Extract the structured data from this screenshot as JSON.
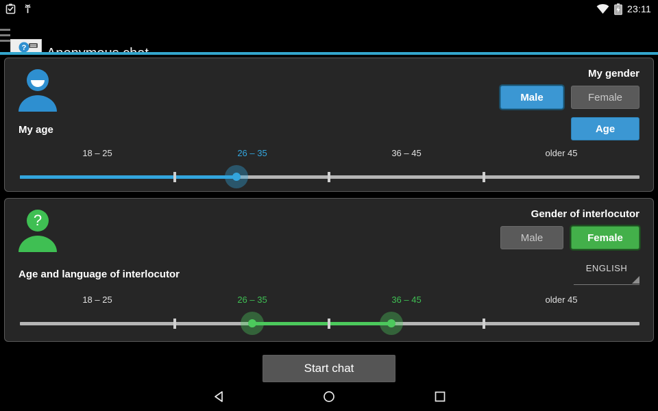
{
  "status_bar": {
    "time": "23:11",
    "left_icons": [
      "clipboard-check-icon",
      "android-robot-icon"
    ],
    "right_icons": [
      "wifi-icon",
      "battery-charging-icon"
    ]
  },
  "action_bar": {
    "title": "Anonymous chat",
    "menu_icon": "hamburger-menu-icon",
    "app_icon": "anonymous-chat-app-icon",
    "accent_color": "#33a5cc"
  },
  "my_section": {
    "gender_title": "My gender",
    "avatar_icon": "male-user-avatar-icon",
    "avatar_color": "#2e8fd0",
    "gender_options": [
      {
        "label": "Male",
        "selected": true,
        "color": "#3b97d3"
      },
      {
        "label": "Female",
        "selected": false,
        "color": "#5a5a5a"
      }
    ],
    "age_label": "My age",
    "age_button": {
      "label": "Age",
      "color": "#3b97d3"
    },
    "slider": {
      "accent_color": "#33a5dd",
      "labels": [
        "18 – 25",
        "26 – 35",
        "36 – 45",
        "older 45"
      ],
      "active_index": 1,
      "value_label": "26 – 35"
    }
  },
  "other_section": {
    "gender_title": "Gender of interlocutor",
    "avatar_icon": "unknown-user-avatar-icon",
    "avatar_color": "#3fbf53",
    "gender_options": [
      {
        "label": "Male",
        "selected": false,
        "color": "#5a5a5a"
      },
      {
        "label": "Female",
        "selected": true,
        "color": "#43b04a"
      }
    ],
    "age_label": "Age and language of interlocutor",
    "language": {
      "value": "ENGLISH",
      "icon": "spinner-dropdown-icon"
    },
    "slider": {
      "accent_color": "#4cc95c",
      "labels": [
        "18 – 25",
        "26 – 35",
        "36 – 45",
        "older 45"
      ],
      "range_from_index": 1,
      "range_to_index": 2,
      "from_label": "26 – 35",
      "to_label": "36 – 45"
    }
  },
  "footer": {
    "start_button": "Start chat"
  },
  "nav_bar": {
    "back_icon": "back-triangle-icon",
    "home_icon": "home-circle-icon",
    "recents_icon": "recents-square-icon"
  }
}
